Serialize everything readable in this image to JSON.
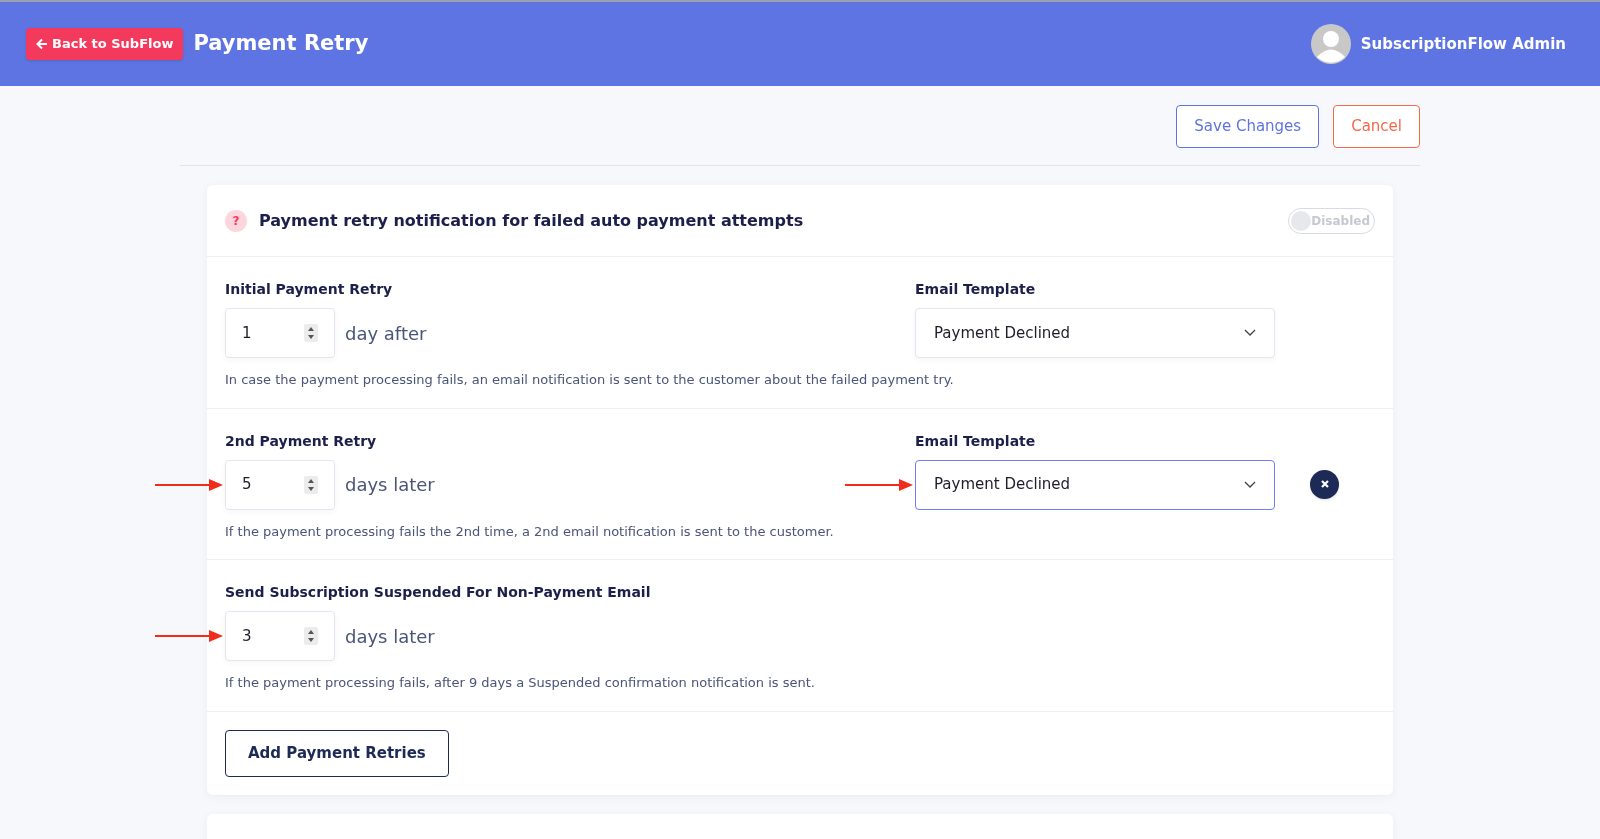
{
  "header": {
    "back_button": "Back to SubFlow",
    "title": "Payment Retry",
    "user": "SubscriptionFlow Admin"
  },
  "actions": {
    "save": "Save Changes",
    "cancel": "Cancel"
  },
  "card": {
    "help_icon": "?",
    "title": "Payment retry notification for failed auto payment attempts",
    "toggle": {
      "on": false,
      "label": "Disabled"
    },
    "rows": [
      {
        "label": "Initial Payment Retry",
        "value": "1",
        "unit": "day after",
        "arrow": false,
        "note": "In case the payment processing fails, an email notification is sent to the customer about the failed payment try.",
        "template": {
          "label": "Email Template",
          "value": "Payment Declined",
          "focused": false,
          "arrow": false
        },
        "removable": false
      },
      {
        "label": "2nd Payment Retry",
        "value": "5",
        "unit": "days later",
        "arrow": true,
        "note": "If the payment processing fails the 2nd time, a 2nd email notification is sent to the customer.",
        "template": {
          "label": "Email Template",
          "value": "Payment Declined",
          "focused": true,
          "arrow": true
        },
        "removable": true
      },
      {
        "label": "Send Subscription Suspended For Non-Payment Email",
        "value": "3",
        "unit": "days later",
        "arrow": true,
        "note": "If the payment processing fails, after 9 days a Suspended confirmation notification is sent."
      }
    ],
    "add_button": "Add Payment Retries"
  }
}
